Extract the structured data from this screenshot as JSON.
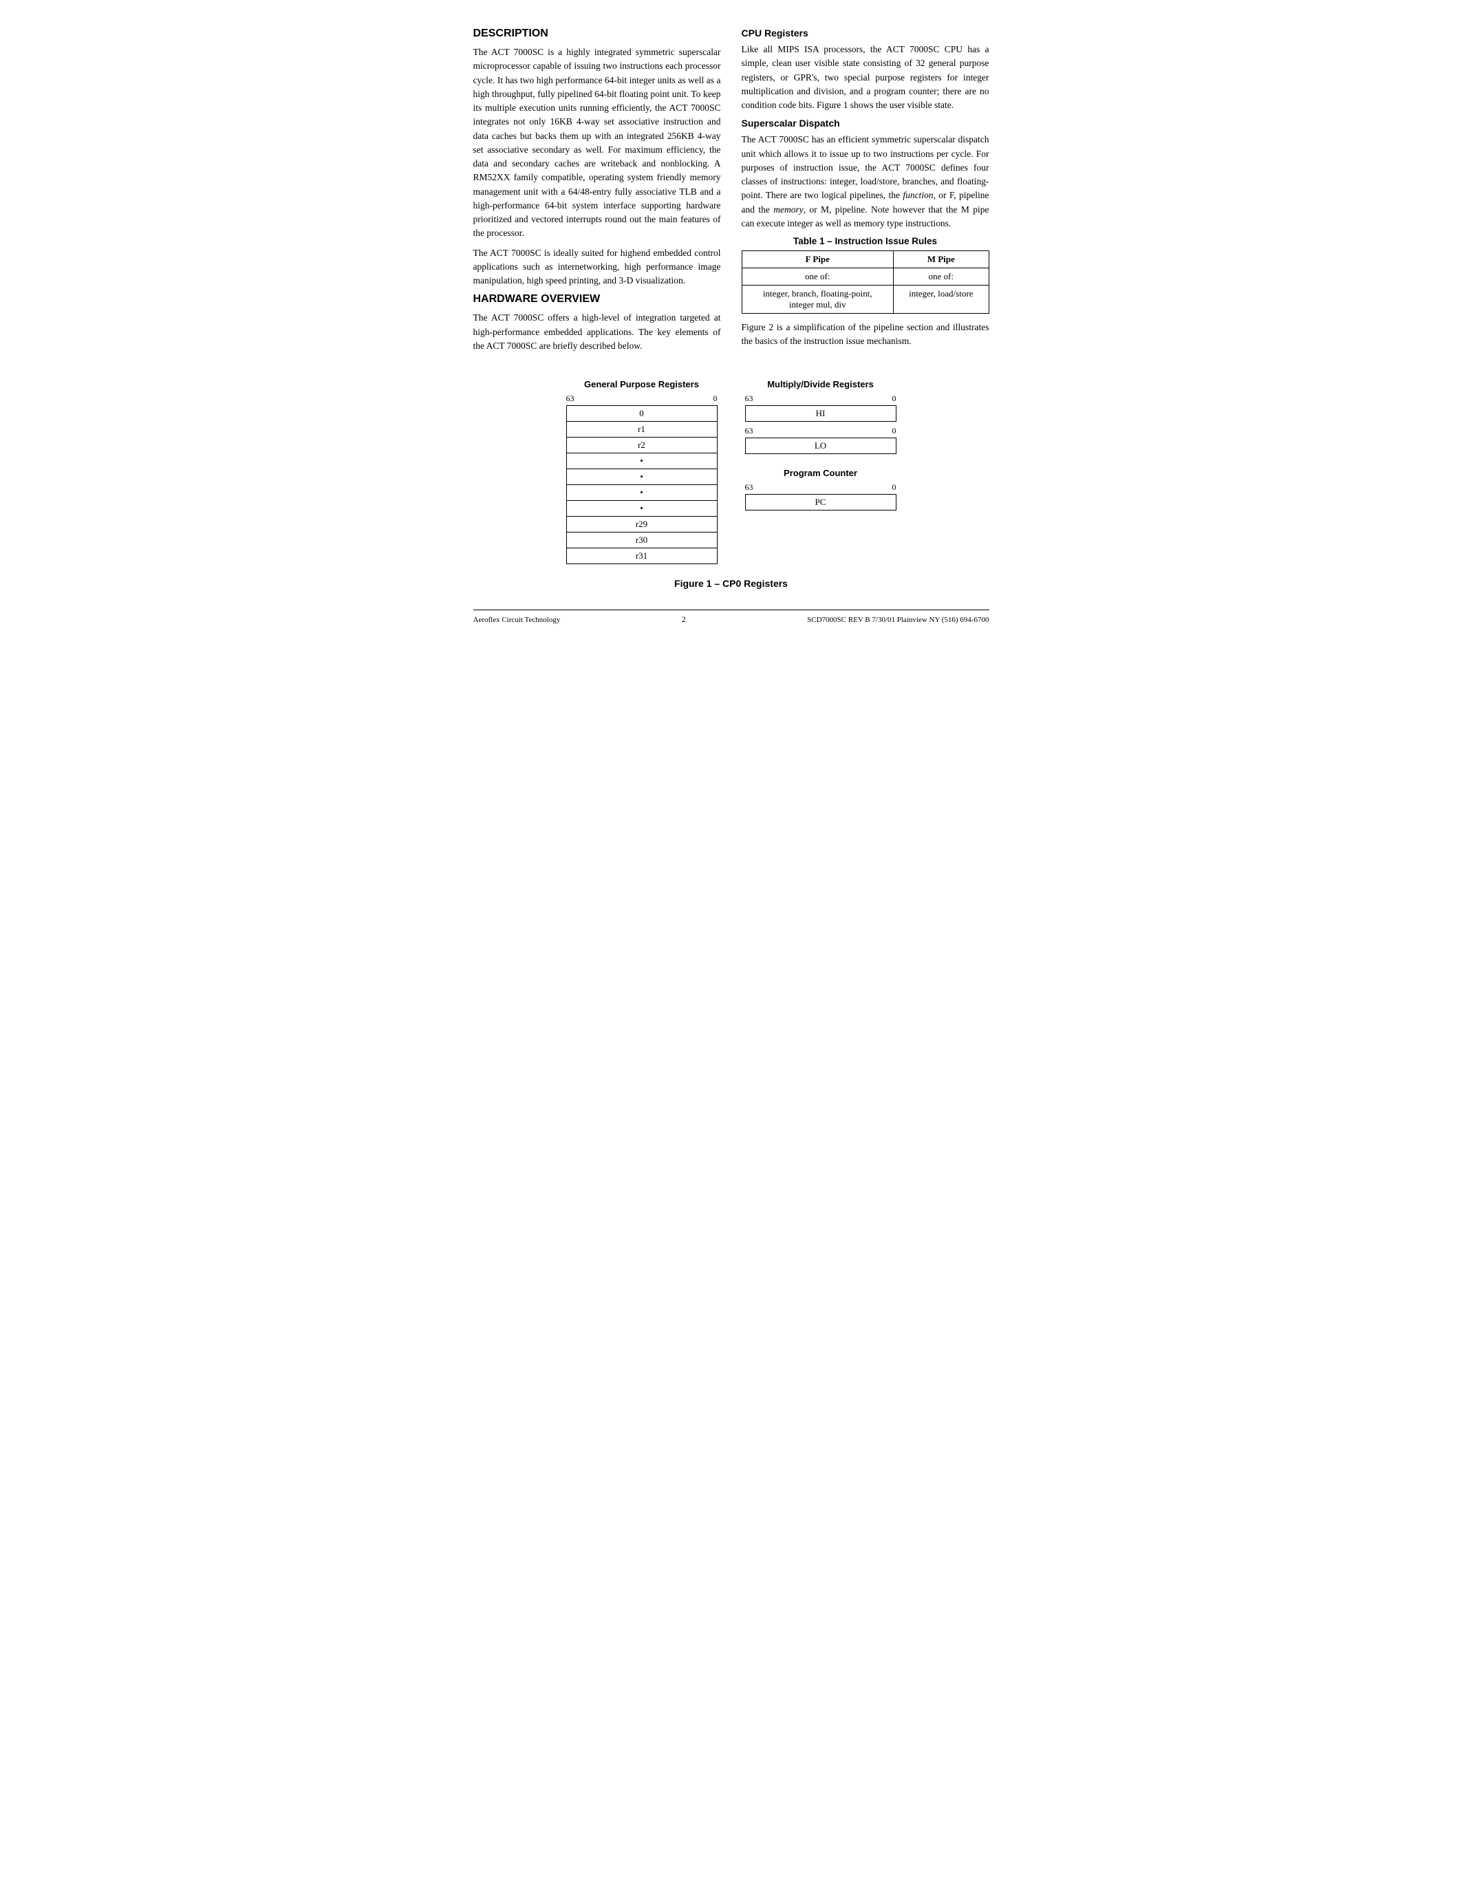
{
  "sections": {
    "description": {
      "title": "DESCRIPTION",
      "paragraphs": [
        "The ACT 7000SC is a highly integrated symmetric superscalar microprocessor capable of issuing two instructions each processor cycle. It has two high performance 64-bit integer units as well as a high throughput, fully pipelined 64-bit floating point unit. To keep its multiple execution units running efficiently, the ACT 7000SC integrates not only 16KB 4-way set associative instruction and data caches but backs them up with an integrated 256KB 4-way set associative secondary as well. For maximum efficiency, the data and secondary caches are writeback and nonblocking. A RM52XX family compatible, operating system friendly memory management unit with a 64/48-entry fully associative TLB and a high-performance 64-bit system interface supporting hardware prioritized and vectored interrupts round out the main features of the processor.",
        "The ACT 7000SC is ideally suited for highend embedded control applications such as internetworking, high performance image manipulation, high speed printing, and 3-D visualization."
      ]
    },
    "hardware_overview": {
      "title": "HARDWARE OVERVIEW",
      "paragraphs": [
        "The ACT 7000SC offers a high-level of integration targeted at high-performance embedded applications. The key elements of the ACT 7000SC are briefly described below."
      ]
    },
    "cpu_registers": {
      "title": "CPU Registers",
      "paragraphs": [
        "Like all MIPS ISA processors, the ACT 7000SC CPU has a simple, clean user visible state consisting of 32 general purpose registers, or GPR's, two special purpose registers for integer multiplication and division, and a program counter; there are no condition code bits. Figure 1 shows the user visible state."
      ]
    },
    "superscalar_dispatch": {
      "title": "Superscalar Dispatch",
      "paragraphs": [
        "The ACT 7000SC has an efficient symmetric superscalar dispatch unit which allows it to issue up to two instructions per cycle. For purposes of instruction issue, the ACT 7000SC defines four classes of instructions: integer, load/store, branches, and floating-point. There are two logical pipelines, the function, or F, pipeline and the memory, or M, pipeline. Note however that the M pipe can execute integer as well as memory type instructions."
      ]
    },
    "table": {
      "title": "Table 1 – Instruction Issue Rules",
      "headers": [
        "F Pipe",
        "M Pipe"
      ],
      "rows": [
        [
          "one of:",
          "one of:"
        ],
        [
          "integer, branch, floating-point,\ninteger mul, div",
          "integer, load/store"
        ]
      ]
    },
    "pipeline_text": "Figure 2 is a simplification of the pipeline section and illustrates the basics of the instruction issue mechanism."
  },
  "figures": {
    "gpr": {
      "label": "General Purpose Registers",
      "bit_high": "63",
      "bit_low": "0",
      "registers": [
        "0",
        "r1",
        "r2",
        "•",
        "•",
        "•",
        "•",
        "r29",
        "r30",
        "r31"
      ]
    },
    "multiply_divide": {
      "label": "Multiply/Divide Registers",
      "registers": [
        {
          "bit_high": "63",
          "bit_low": "0",
          "name": "HI"
        },
        {
          "bit_high": "63",
          "bit_low": "0",
          "name": "LO"
        }
      ]
    },
    "program_counter": {
      "label": "Program Counter",
      "bit_high": "63",
      "bit_low": "0",
      "name": "PC"
    },
    "caption": "Figure 1 – CP0 Registers"
  },
  "footer": {
    "left": "Aeroflex Circuit Technology",
    "center": "2",
    "right": "SCD7000SC REV B  7/30/01  Plainview NY (516) 694-6700"
  }
}
